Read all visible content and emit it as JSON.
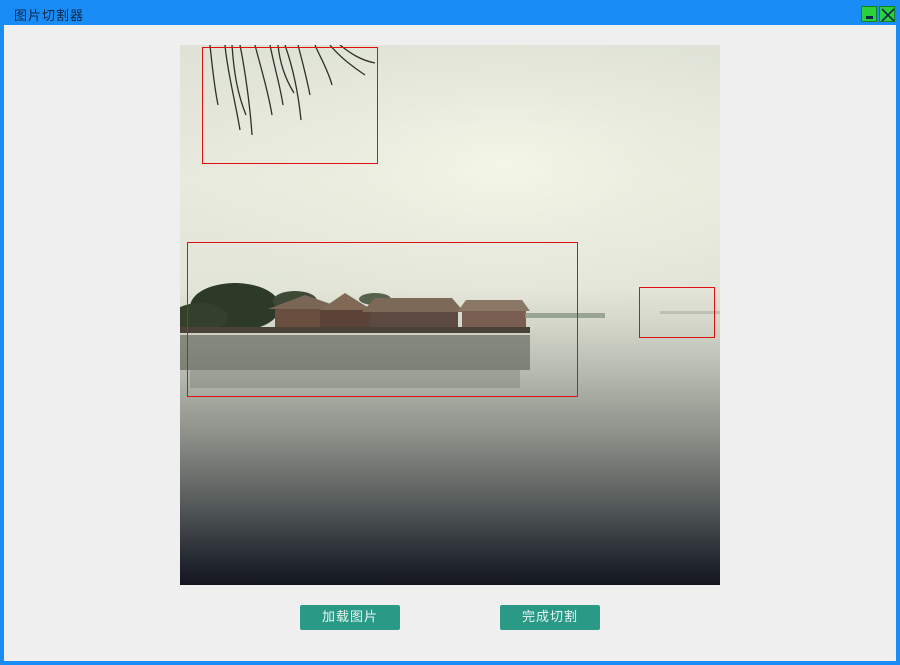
{
  "window": {
    "title": "图片切割器"
  },
  "titlebar": {
    "minimize_icon": "minimize-icon",
    "close_icon": "close-icon"
  },
  "image": {
    "description_icon": "lake-photo",
    "crop_regions": 3
  },
  "buttons": {
    "load_label": "加载图片",
    "finish_label": "完成切割"
  },
  "colors": {
    "titlebar": "#1a8cf5",
    "client_bg": "#efefef",
    "button": "#2a9a86",
    "crop_border": "#e01010"
  }
}
